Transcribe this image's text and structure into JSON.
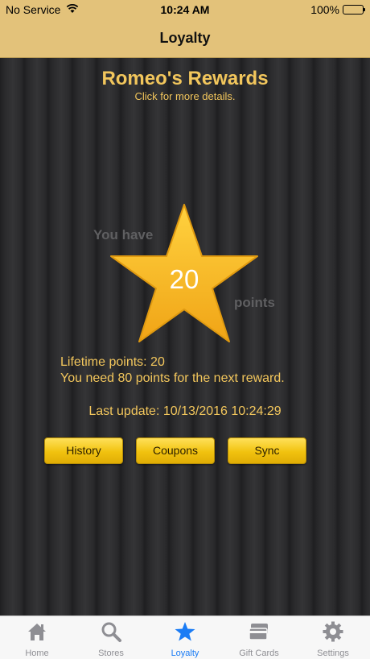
{
  "status": {
    "carrier": "No Service",
    "time": "10:24 AM",
    "battery": "100%"
  },
  "nav": {
    "title": "Loyalty"
  },
  "rewards": {
    "title": "Romeo's Rewards",
    "subtitle": "Click for more details.",
    "you_have": "You have",
    "points_value": "20",
    "points_word": "points",
    "lifetime": "Lifetime points: 20",
    "needed": "You need 80 points for the next reward.",
    "last_update": "Last update: 10/13/2016 10:24:29"
  },
  "buttons": {
    "history": "History",
    "coupons": "Coupons",
    "sync": "Sync"
  },
  "colors": {
    "accent": "#e3c27a",
    "gold_text": "#f2c65c",
    "star": "#f5b82a",
    "active_tab": "#1a7cf5"
  },
  "tabs": [
    {
      "label": "Home",
      "icon": "home-icon"
    },
    {
      "label": "Stores",
      "icon": "search-icon"
    },
    {
      "label": "Loyalty",
      "icon": "star-icon",
      "active": true
    },
    {
      "label": "Gift Cards",
      "icon": "gift-cards-icon"
    },
    {
      "label": "Settings",
      "icon": "gear-icon"
    }
  ]
}
